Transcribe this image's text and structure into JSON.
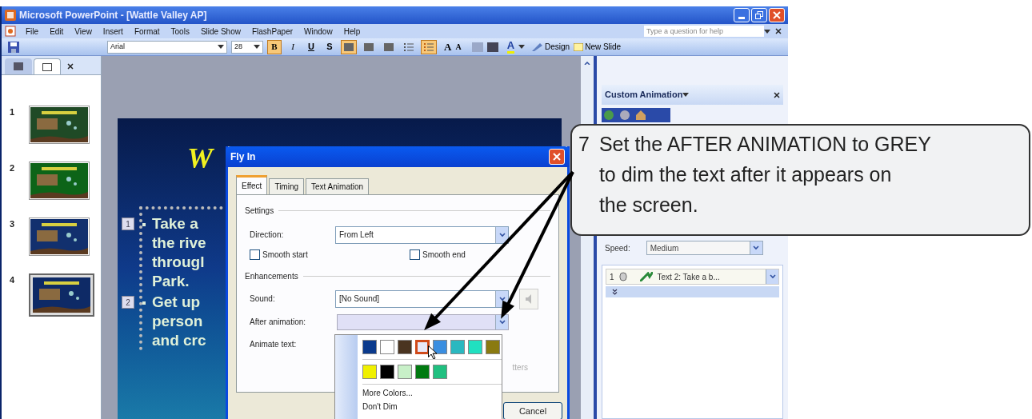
{
  "window": {
    "title": "Microsoft PowerPoint - [Wattle Valley AP]"
  },
  "menu": [
    "File",
    "Edit",
    "View",
    "Insert",
    "Format",
    "Tools",
    "Slide Show",
    "FlashPaper",
    "Window",
    "Help"
  ],
  "help": {
    "placeholder": "Type a question for help"
  },
  "toolbar": {
    "font": "Arial",
    "size": "28",
    "style_buttons": [
      {
        "label": "B",
        "kind": "bold",
        "on": true
      },
      {
        "label": "I",
        "kind": "italic",
        "on": false
      },
      {
        "label": "U",
        "kind": "underline",
        "on": false
      },
      {
        "label": "S",
        "kind": "shadow",
        "on": false
      }
    ],
    "align_buttons": [
      {
        "on": true
      },
      {
        "on": false
      },
      {
        "on": false
      }
    ],
    "list_buttons": [
      {
        "kind": "numbered",
        "on": false
      },
      {
        "kind": "bulleted",
        "on": true
      }
    ],
    "grow_font": "A",
    "shrink_font": "A",
    "font_color": "A",
    "design": "Design",
    "new_slide": "New Slide"
  },
  "panel_tabs": [
    {
      "kind": "outline",
      "selected": false
    },
    {
      "kind": "slides",
      "selected": true
    }
  ],
  "thumbnails": [
    {
      "number": "1",
      "color": "#1f4a26",
      "selected": false
    },
    {
      "number": "2",
      "color": "#0d6418",
      "selected": false
    },
    {
      "number": "3",
      "color": "#12306e",
      "selected": false
    },
    {
      "number": "4",
      "color": "#0e2a66",
      "selected": true
    }
  ],
  "slide": {
    "title": "W",
    "bullets": [
      {
        "tag": "1",
        "lines": [
          "Take a",
          "the rive",
          "througl",
          "Park."
        ]
      },
      {
        "tag": "2",
        "lines": [
          "Get up",
          "person",
          "and crc"
        ]
      }
    ]
  },
  "dialog": {
    "title": "Fly In",
    "tabs": [
      {
        "label": "Effect",
        "selected": true
      },
      {
        "label": "Timing",
        "selected": false
      },
      {
        "label": "Text Animation",
        "selected": false
      }
    ],
    "settings_label": "Settings",
    "direction_label": "Direction:",
    "direction": "From Left",
    "checkboxes": [
      {
        "label": "Smooth start",
        "checked": false
      },
      {
        "label": "Smooth end",
        "checked": false
      }
    ],
    "enhancements_label": "Enhancements",
    "sound_label": "Sound:",
    "sound": "[No Sound]",
    "after_label": "After animation:",
    "animate_label": "Animate text:",
    "partial_text": "tters",
    "cancel": "Cancel"
  },
  "color_menu": {
    "rows": [
      [
        {
          "color": "#0b3a8c",
          "selected": false
        },
        {
          "color": "#ffffff",
          "selected": false
        },
        {
          "color": "#4a3420",
          "selected": false
        },
        {
          "color": "#e8e8f8",
          "selected": true
        },
        {
          "color": "#3a8ee0",
          "selected": false
        },
        {
          "color": "#2ab8c0",
          "selected": false
        },
        {
          "color": "#20e0c0",
          "selected": false
        },
        {
          "color": "#8a7a10",
          "selected": false
        }
      ],
      [
        {
          "color": "#f0f000",
          "selected": false
        },
        {
          "color": "#000000",
          "selected": false
        },
        {
          "color": "#c8f0c8",
          "selected": false
        },
        {
          "color": "#007a10",
          "selected": false
        },
        {
          "color": "#20c080",
          "selected": false
        }
      ]
    ],
    "items": [
      "More Colors...",
      "Don't Dim"
    ]
  },
  "task_pane": {
    "title": "Custom Animation",
    "speed_label": "Speed:",
    "speed": "Medium",
    "items": [
      {
        "order": "1",
        "text": "Text 2: Take a b..."
      }
    ]
  },
  "callout": {
    "step": "7",
    "lines": [
      "Set the AFTER ANIMATION to GREY",
      "to dim the text after it appears on",
      "the screen."
    ]
  }
}
